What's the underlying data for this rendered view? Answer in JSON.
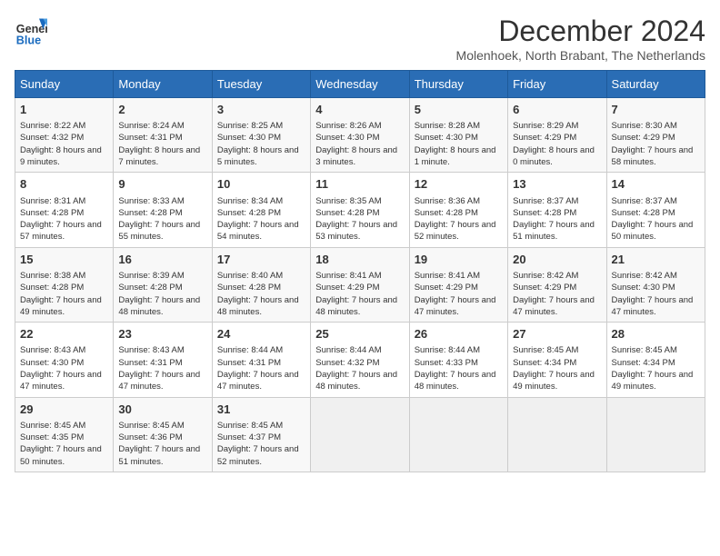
{
  "logo": {
    "general": "General",
    "blue": "Blue"
  },
  "title": "December 2024",
  "location": "Molenhoek, North Brabant, The Netherlands",
  "days_of_week": [
    "Sunday",
    "Monday",
    "Tuesday",
    "Wednesday",
    "Thursday",
    "Friday",
    "Saturday"
  ],
  "weeks": [
    [
      {
        "day": "1",
        "sunrise": "8:22 AM",
        "sunset": "4:32 PM",
        "daylight": "8 hours and 9 minutes."
      },
      {
        "day": "2",
        "sunrise": "8:24 AM",
        "sunset": "4:31 PM",
        "daylight": "8 hours and 7 minutes."
      },
      {
        "day": "3",
        "sunrise": "8:25 AM",
        "sunset": "4:30 PM",
        "daylight": "8 hours and 5 minutes."
      },
      {
        "day": "4",
        "sunrise": "8:26 AM",
        "sunset": "4:30 PM",
        "daylight": "8 hours and 3 minutes."
      },
      {
        "day": "5",
        "sunrise": "8:28 AM",
        "sunset": "4:30 PM",
        "daylight": "8 hours and 1 minute."
      },
      {
        "day": "6",
        "sunrise": "8:29 AM",
        "sunset": "4:29 PM",
        "daylight": "8 hours and 0 minutes."
      },
      {
        "day": "7",
        "sunrise": "8:30 AM",
        "sunset": "4:29 PM",
        "daylight": "7 hours and 58 minutes."
      }
    ],
    [
      {
        "day": "8",
        "sunrise": "8:31 AM",
        "sunset": "4:28 PM",
        "daylight": "7 hours and 57 minutes."
      },
      {
        "day": "9",
        "sunrise": "8:33 AM",
        "sunset": "4:28 PM",
        "daylight": "7 hours and 55 minutes."
      },
      {
        "day": "10",
        "sunrise": "8:34 AM",
        "sunset": "4:28 PM",
        "daylight": "7 hours and 54 minutes."
      },
      {
        "day": "11",
        "sunrise": "8:35 AM",
        "sunset": "4:28 PM",
        "daylight": "7 hours and 53 minutes."
      },
      {
        "day": "12",
        "sunrise": "8:36 AM",
        "sunset": "4:28 PM",
        "daylight": "7 hours and 52 minutes."
      },
      {
        "day": "13",
        "sunrise": "8:37 AM",
        "sunset": "4:28 PM",
        "daylight": "7 hours and 51 minutes."
      },
      {
        "day": "14",
        "sunrise": "8:37 AM",
        "sunset": "4:28 PM",
        "daylight": "7 hours and 50 minutes."
      }
    ],
    [
      {
        "day": "15",
        "sunrise": "8:38 AM",
        "sunset": "4:28 PM",
        "daylight": "7 hours and 49 minutes."
      },
      {
        "day": "16",
        "sunrise": "8:39 AM",
        "sunset": "4:28 PM",
        "daylight": "7 hours and 48 minutes."
      },
      {
        "day": "17",
        "sunrise": "8:40 AM",
        "sunset": "4:28 PM",
        "daylight": "7 hours and 48 minutes."
      },
      {
        "day": "18",
        "sunrise": "8:41 AM",
        "sunset": "4:29 PM",
        "daylight": "7 hours and 48 minutes."
      },
      {
        "day": "19",
        "sunrise": "8:41 AM",
        "sunset": "4:29 PM",
        "daylight": "7 hours and 47 minutes."
      },
      {
        "day": "20",
        "sunrise": "8:42 AM",
        "sunset": "4:29 PM",
        "daylight": "7 hours and 47 minutes."
      },
      {
        "day": "21",
        "sunrise": "8:42 AM",
        "sunset": "4:30 PM",
        "daylight": "7 hours and 47 minutes."
      }
    ],
    [
      {
        "day": "22",
        "sunrise": "8:43 AM",
        "sunset": "4:30 PM",
        "daylight": "7 hours and 47 minutes."
      },
      {
        "day": "23",
        "sunrise": "8:43 AM",
        "sunset": "4:31 PM",
        "daylight": "7 hours and 47 minutes."
      },
      {
        "day": "24",
        "sunrise": "8:44 AM",
        "sunset": "4:31 PM",
        "daylight": "7 hours and 47 minutes."
      },
      {
        "day": "25",
        "sunrise": "8:44 AM",
        "sunset": "4:32 PM",
        "daylight": "7 hours and 48 minutes."
      },
      {
        "day": "26",
        "sunrise": "8:44 AM",
        "sunset": "4:33 PM",
        "daylight": "7 hours and 48 minutes."
      },
      {
        "day": "27",
        "sunrise": "8:45 AM",
        "sunset": "4:34 PM",
        "daylight": "7 hours and 49 minutes."
      },
      {
        "day": "28",
        "sunrise": "8:45 AM",
        "sunset": "4:34 PM",
        "daylight": "7 hours and 49 minutes."
      }
    ],
    [
      {
        "day": "29",
        "sunrise": "8:45 AM",
        "sunset": "4:35 PM",
        "daylight": "7 hours and 50 minutes."
      },
      {
        "day": "30",
        "sunrise": "8:45 AM",
        "sunset": "4:36 PM",
        "daylight": "7 hours and 51 minutes."
      },
      {
        "day": "31",
        "sunrise": "8:45 AM",
        "sunset": "4:37 PM",
        "daylight": "7 hours and 52 minutes."
      },
      null,
      null,
      null,
      null
    ]
  ]
}
